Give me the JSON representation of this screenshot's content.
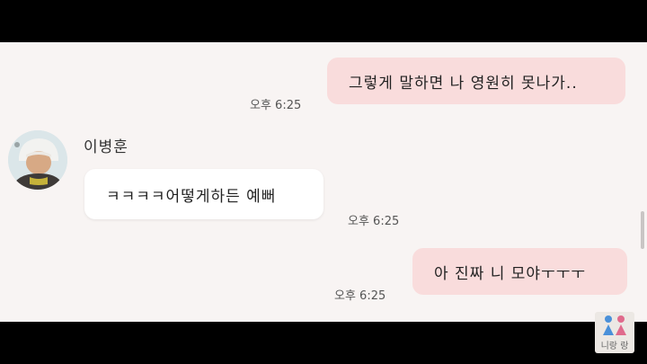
{
  "messages": [
    {
      "side": "me",
      "text": "그렇게 말하면 나 영원히 못나가..",
      "time": "오후 6:25"
    },
    {
      "side": "other",
      "sender": "이병훈",
      "text": "ㅋㅋㅋㅋ어떻게하든 예뻐",
      "time": "오후 6:25"
    },
    {
      "side": "me",
      "text": "아 진짜 니 모야ㅜㅜㅜ",
      "time": "오후 6:25"
    }
  ],
  "watermark": {
    "icon": "two-people-icon",
    "text": "니랑 랑"
  },
  "colors": {
    "my_bubble": "#f9dcdc",
    "other_bubble": "#ffffff",
    "background": "#f8f4f3"
  }
}
